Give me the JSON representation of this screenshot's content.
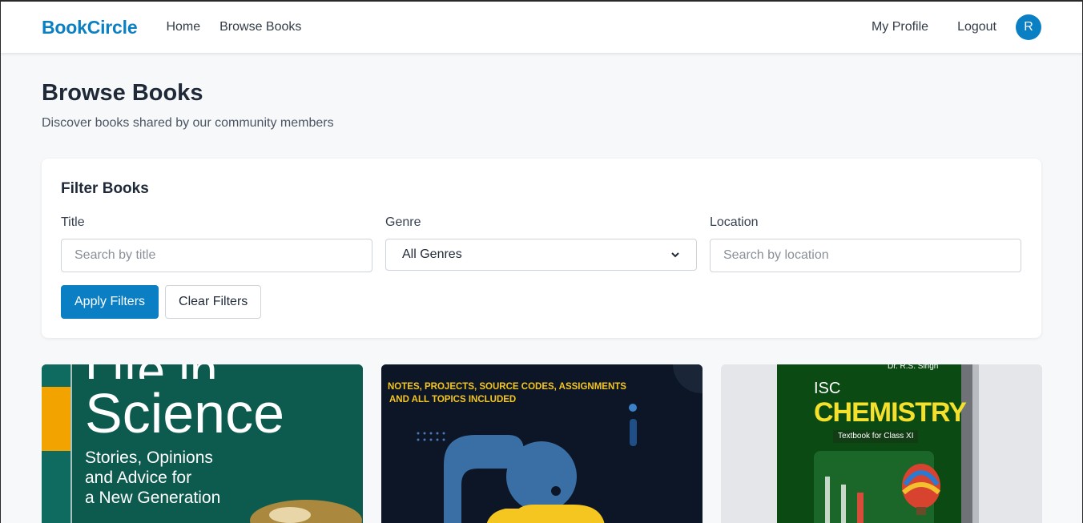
{
  "nav": {
    "brand": "BookCircle",
    "links": [
      "Home",
      "Browse Books"
    ],
    "profile": "My Profile",
    "logout": "Logout",
    "avatar_initial": "R"
  },
  "header": {
    "title": "Browse Books",
    "subtitle": "Discover books shared by our community members"
  },
  "filters": {
    "heading": "Filter Books",
    "title_label": "Title",
    "title_placeholder": "Search by title",
    "genre_label": "Genre",
    "genre_selected": "All Genres",
    "location_label": "Location",
    "location_placeholder": "Search by location",
    "apply": "Apply Filters",
    "clear": "Clear Filters"
  },
  "books": [
    {
      "cover_lines": [
        "Life in",
        "Science",
        "Stories, Opinions",
        "and Advice for",
        "a New Generation"
      ]
    },
    {
      "cover_lines": [
        "NOTES, PROJECTS, SOURCE CODES, ASSIGNMENTS",
        "AND ALL TOPICS INCLUDED"
      ]
    },
    {
      "cover_lines": [
        "Dr. R.S. Singh",
        "ISC",
        "CHEMISTRY",
        "Textbook for Class XI"
      ]
    }
  ],
  "colors": {
    "brand": "#0b7fc3",
    "background": "#f7f8fa"
  }
}
